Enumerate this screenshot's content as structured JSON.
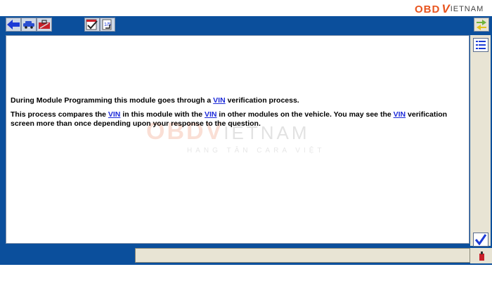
{
  "logo": {
    "obd": "OBD",
    "v": "V",
    "rest": "IETNAM"
  },
  "watermark": {
    "brand_a": "OBD",
    "brand_b": "V",
    "brand_c": "IETNAM",
    "tagline": "HANG TÂN CARA VIỆT"
  },
  "content": {
    "p1_a": "During Module Programming this module goes through a ",
    "p1_link": "VIN",
    "p1_b": " verification process.",
    "p2_a": "This process compares the ",
    "p2_link1": "VIN",
    "p2_b": " in this module with the ",
    "p2_link2": "VIN",
    "p2_c": " in other modules on the vehicle. You may see the ",
    "p2_link3": "VIN",
    "p2_d": " verification screen more than once depending upon your response to the question."
  },
  "icons": {
    "back": "back-arrow-icon",
    "vehicle": "vehicle-icon",
    "toolbox": "toolbox-icon",
    "checklist": "checklist-icon",
    "page_flip": "page-flip-icon",
    "swap": "swap-arrows-icon",
    "list": "list-icon",
    "tick": "checkmark-icon",
    "cable": "vcm-cable-icon"
  },
  "colors": {
    "frame": "#0b4f9c",
    "link": "#1d2bd9",
    "side": "#e8e4d4",
    "brand": "#e8541e"
  }
}
